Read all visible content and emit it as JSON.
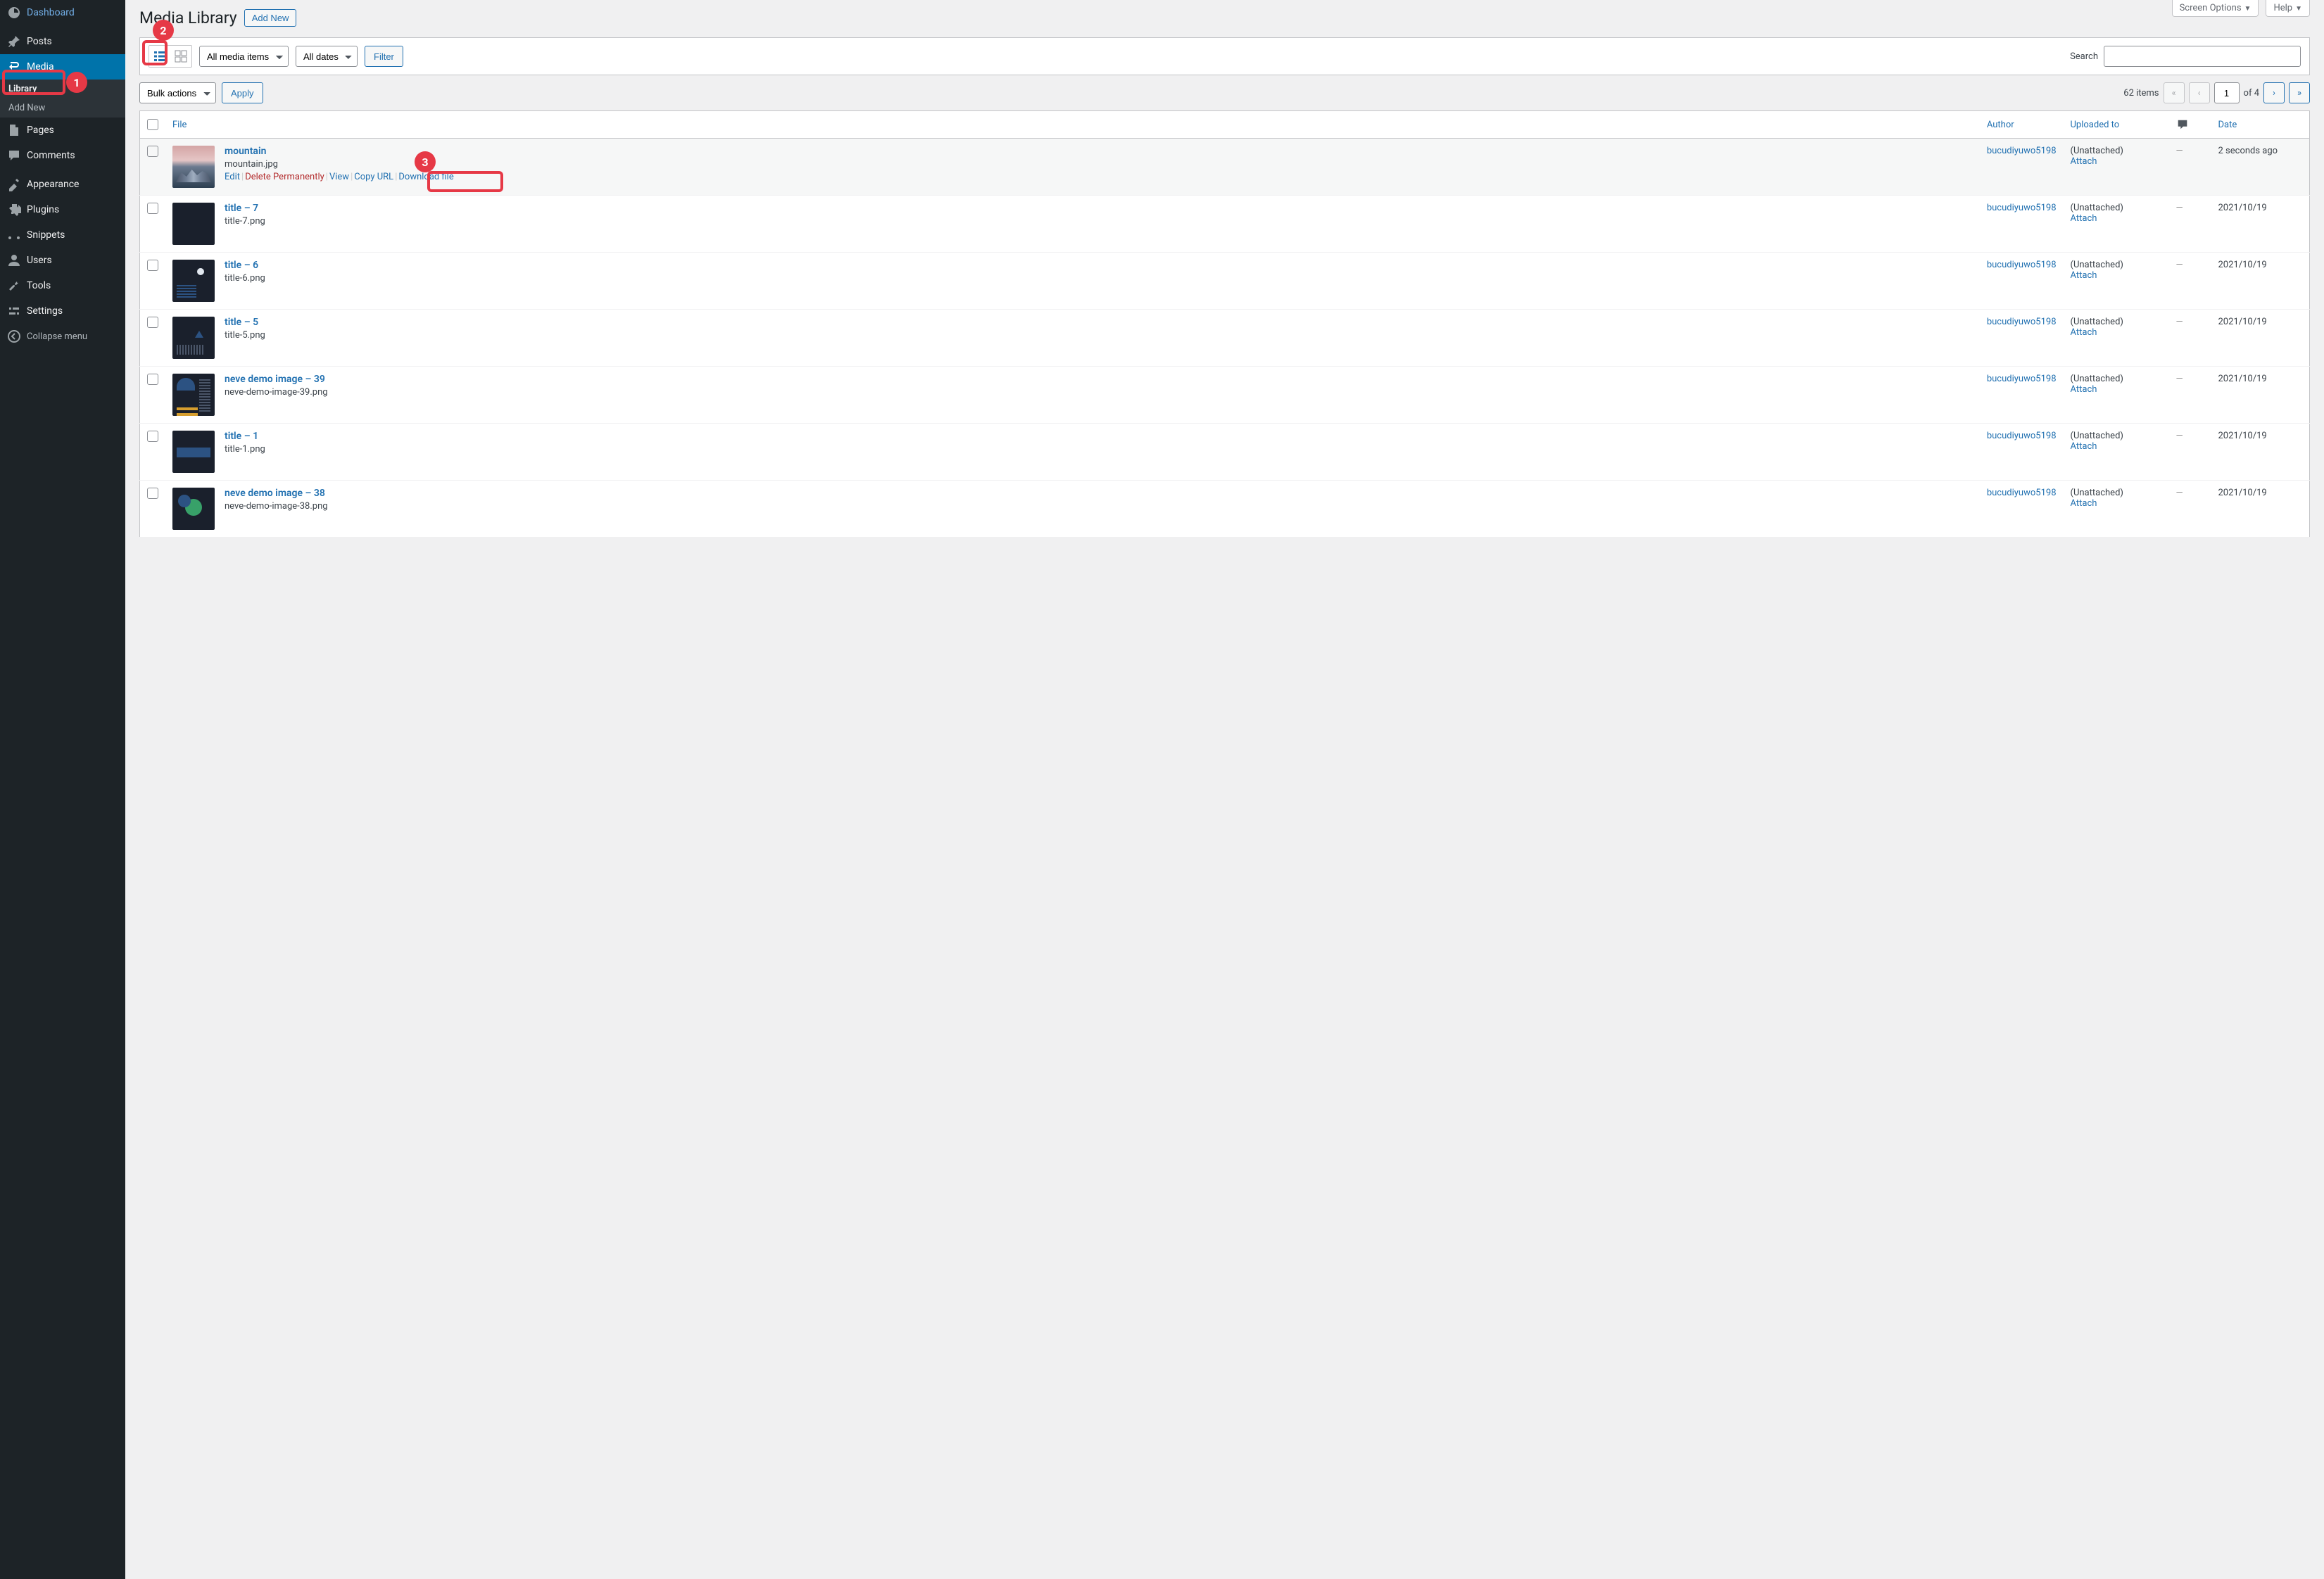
{
  "topTabs": {
    "screenOptions": "Screen Options",
    "help": "Help"
  },
  "sidebar": {
    "dashboard": "Dashboard",
    "posts": "Posts",
    "media": "Media",
    "mediaSub": {
      "library": "Library",
      "addNew": "Add New"
    },
    "pages": "Pages",
    "comments": "Comments",
    "appearance": "Appearance",
    "plugins": "Plugins",
    "snippets": "Snippets",
    "users": "Users",
    "tools": "Tools",
    "settings": "Settings",
    "collapse": "Collapse menu"
  },
  "page": {
    "title": "Media Library",
    "addNew": "Add New"
  },
  "filterBar": {
    "mediaItems": "All media items",
    "allDates": "All dates",
    "filter": "Filter",
    "searchLabel": "Search"
  },
  "bulk": {
    "bulkActions": "Bulk actions",
    "apply": "Apply"
  },
  "pagination": {
    "items": "62 items",
    "page": "1",
    "of": "of 4"
  },
  "columns": {
    "file": "File",
    "author": "Author",
    "uploadedTo": "Uploaded to",
    "date": "Date"
  },
  "rowActions": {
    "edit": "Edit",
    "deletePermanently": "Delete Permanently",
    "view": "View",
    "copyUrl": "Copy URL",
    "downloadFile": "Download file"
  },
  "attach": {
    "unattached": "(Unattached)",
    "attach": "Attach"
  },
  "rows": [
    {
      "title": "mountain",
      "filename": "mountain.jpg",
      "author": "bucudiyuwo5198",
      "date": "2 seconds ago",
      "thumb": "thumb-mountain",
      "showActions": true
    },
    {
      "title": "title – 7",
      "filename": "title-7.png",
      "author": "bucudiyuwo5198",
      "date": "2021/10/19",
      "thumb": "thumb-t7",
      "showActions": false
    },
    {
      "title": "title – 6",
      "filename": "title-6.png",
      "author": "bucudiyuwo5198",
      "date": "2021/10/19",
      "thumb": "thumb-t6",
      "showActions": false
    },
    {
      "title": "title – 5",
      "filename": "title-5.png",
      "author": "bucudiyuwo5198",
      "date": "2021/10/19",
      "thumb": "thumb-t5",
      "showActions": false
    },
    {
      "title": "neve demo image – 39",
      "filename": "neve-demo-image-39.png",
      "author": "bucudiyuwo5198",
      "date": "2021/10/19",
      "thumb": "thumb-neve39",
      "showActions": false
    },
    {
      "title": "title – 1",
      "filename": "title-1.png",
      "author": "bucudiyuwo5198",
      "date": "2021/10/19",
      "thumb": "thumb-t1",
      "showActions": false
    },
    {
      "title": "neve demo image – 38",
      "filename": "neve-demo-image-38.png",
      "author": "bucudiyuwo5198",
      "date": "2021/10/19",
      "thumb": "thumb-neve38",
      "showActions": false
    }
  ],
  "annotations": {
    "n1": "1",
    "n2": "2",
    "n3": "3"
  }
}
